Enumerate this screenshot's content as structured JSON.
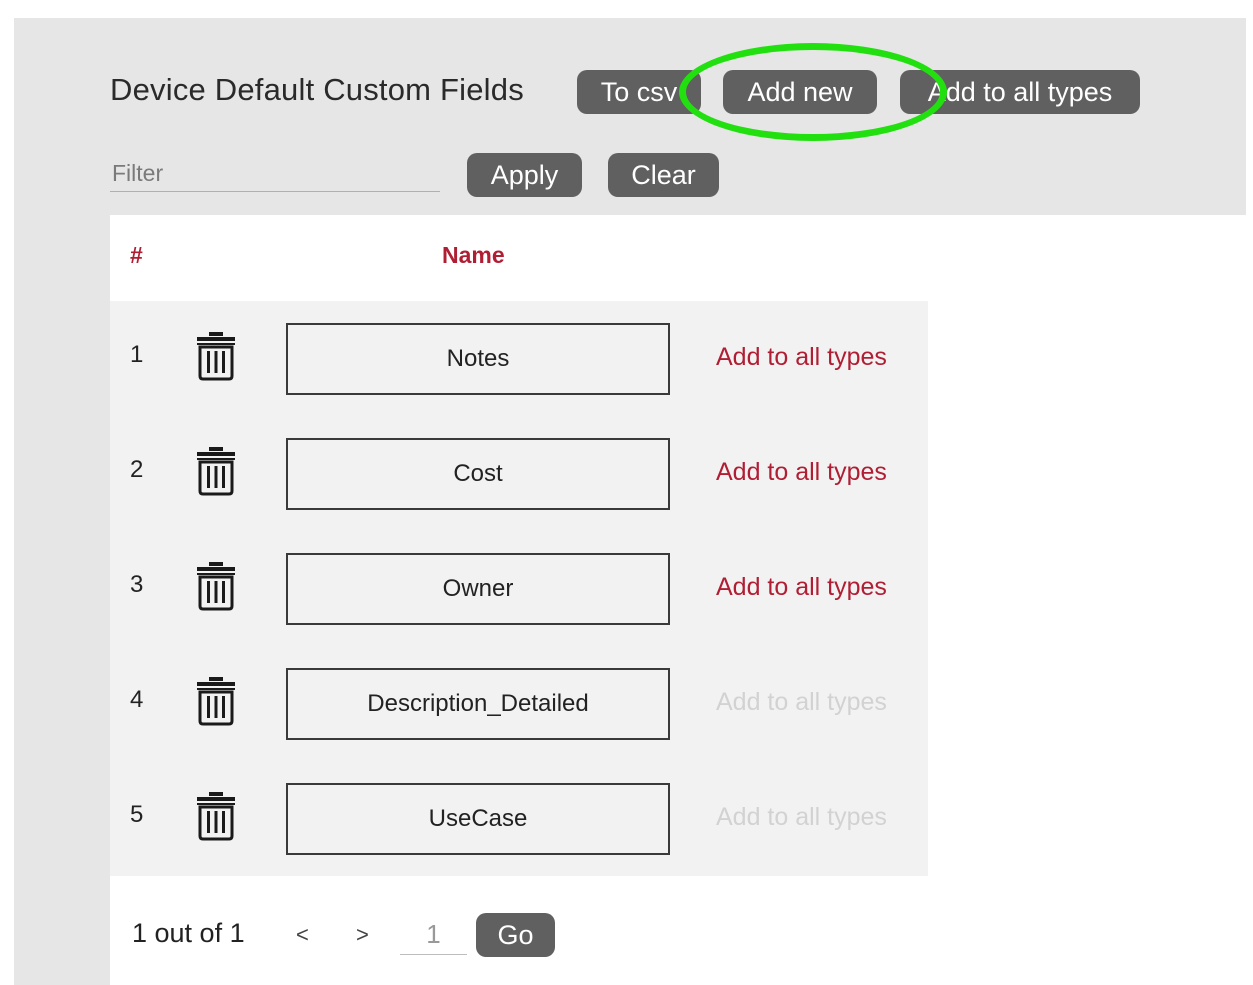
{
  "header": {
    "title": "Device Default Custom Fields",
    "to_csv_label": "To csv",
    "add_new_label": "Add new",
    "add_to_all_types_label": "Add to all types"
  },
  "filter": {
    "placeholder": "Filter",
    "value": "",
    "apply_label": "Apply",
    "clear_label": "Clear"
  },
  "table": {
    "columns": [
      "#",
      "Name"
    ],
    "rows": [
      {
        "num": "1",
        "name": "Notes",
        "action": "Add to all types",
        "action_enabled": true
      },
      {
        "num": "2",
        "name": "Cost",
        "action": "Add to all types",
        "action_enabled": true
      },
      {
        "num": "3",
        "name": "Owner",
        "action": "Add to all types",
        "action_enabled": true
      },
      {
        "num": "4",
        "name": "Description_Detailed",
        "action": "Add to all types",
        "action_enabled": false
      },
      {
        "num": "5",
        "name": "UseCase",
        "action": "Add to all types",
        "action_enabled": false
      }
    ]
  },
  "pager": {
    "summary": "1 out of 1",
    "prev": "<",
    "next": ">",
    "page_value": "1",
    "go_label": "Go"
  },
  "colors": {
    "accent": "#b01e34",
    "button_bg": "#606060",
    "disabled_text": "#d2d2d2",
    "highlight_annotation": "#22e010"
  },
  "icons": {
    "row_delete": "trash-icon"
  }
}
